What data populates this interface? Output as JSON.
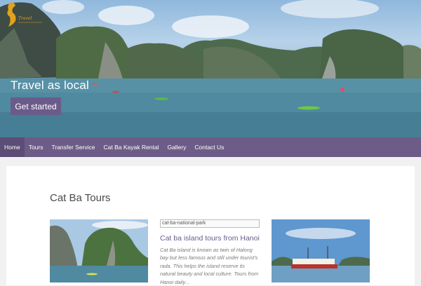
{
  "hero": {
    "title": "Travel as local",
    "cta_label": "Get started",
    "logo_icon": "vietnam-map-logo-icon"
  },
  "nav": {
    "items": [
      {
        "label": "Home",
        "active": true
      },
      {
        "label": "Tours",
        "active": false
      },
      {
        "label": "Transfer Service",
        "active": false
      },
      {
        "label": "Cat Ba Kayak Rental",
        "active": false
      },
      {
        "label": "Gallery",
        "active": false
      },
      {
        "label": "Contact Us",
        "active": false
      }
    ]
  },
  "main": {
    "section_title": "Cat Ba Tours",
    "cards": [
      {
        "image": "limestone-islands-photo"
      },
      {
        "image_alt": "cat-ba-national-park",
        "title": "Cat ba island tours from Hanoi",
        "excerpt": "Cat Ba island is known as twin of Halong bay but less famous and still under tourist's rada. This helps the island reserve its natural beauty and local culture. Tours from Hanoi daily..."
      },
      {
        "image": "tour-boat-photo"
      }
    ]
  },
  "colors": {
    "brand": "#6c5c87",
    "nav_active": "#5b4d75",
    "button": "#6b5b8a",
    "page_bg": "#f1f1f1"
  }
}
